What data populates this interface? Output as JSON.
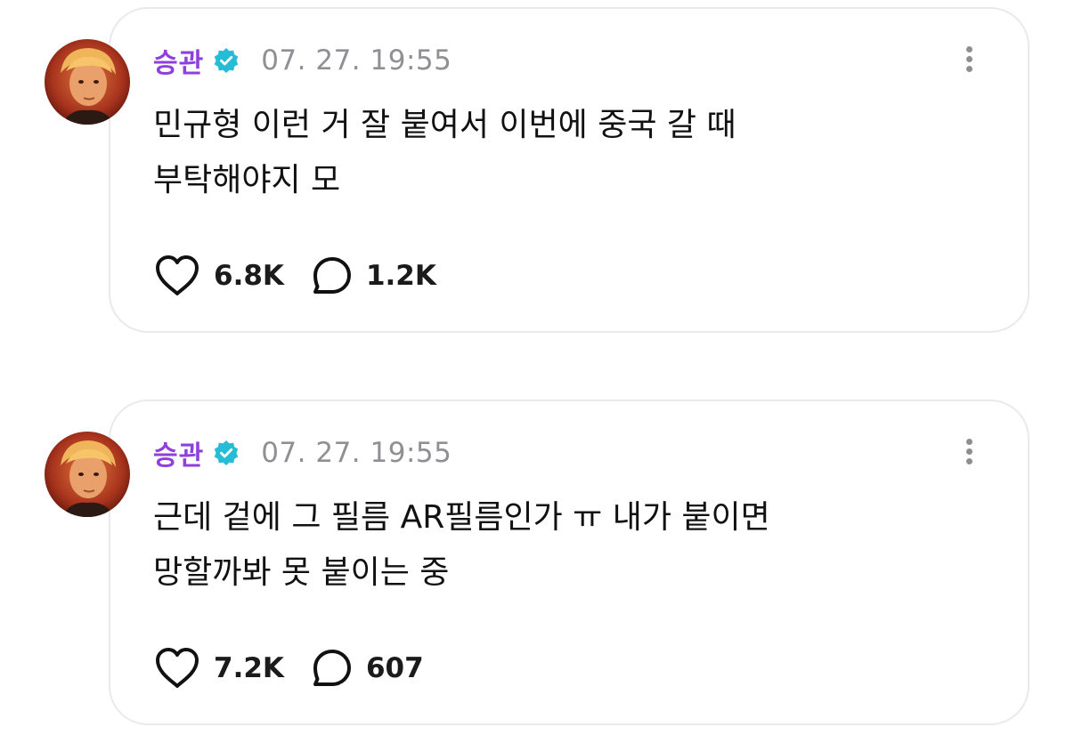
{
  "colors": {
    "author_name": "#8e3fdc",
    "verified_badge": "#27bcd6",
    "timestamp": "#8f8f94",
    "card_border": "#e9e9ee"
  },
  "posts": [
    {
      "author": "승관",
      "verified": true,
      "timestamp": "07. 27. 19:55",
      "text_lines": [
        "민규형 이런 거 잘 붙여서 이번에 중국 갈 때",
        "부탁해야지 모"
      ],
      "likes": "6.8K",
      "comments": "1.2K",
      "icons": [
        "heart-icon",
        "comment-bubble-icon",
        "more-vertical-icon",
        "verified-badge-icon"
      ]
    },
    {
      "author": "승관",
      "verified": true,
      "timestamp": "07. 27. 19:55",
      "text_lines": [
        "근데 겉에 그 필름 AR필름인가 ㅠ 내가 붙이면",
        "망할까봐 못 붙이는 중"
      ],
      "likes": "7.2K",
      "comments": "607",
      "icons": [
        "heart-icon",
        "comment-bubble-icon",
        "more-vertical-icon",
        "verified-badge-icon"
      ]
    }
  ]
}
